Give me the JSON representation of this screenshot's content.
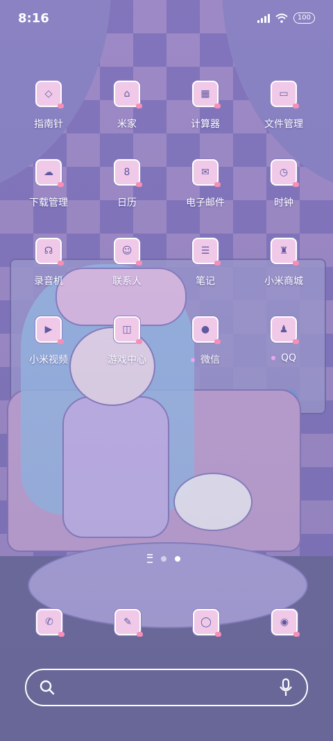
{
  "status_bar": {
    "time": "8:16",
    "battery": "100"
  },
  "apps": [
    {
      "label": "指南针",
      "icon": "compass-icon",
      "glyph": "◇"
    },
    {
      "label": "米家",
      "icon": "mi-home-icon",
      "glyph": "⌂"
    },
    {
      "label": "计算器",
      "icon": "calculator-icon",
      "glyph": "▦"
    },
    {
      "label": "文件管理",
      "icon": "folder-icon",
      "glyph": "▭"
    },
    {
      "label": "下载管理",
      "icon": "download-icon",
      "glyph": "☁"
    },
    {
      "label": "日历",
      "icon": "calendar-icon",
      "glyph": "8"
    },
    {
      "label": "电子邮件",
      "icon": "mail-icon",
      "glyph": "✉"
    },
    {
      "label": "时钟",
      "icon": "clock-icon",
      "glyph": "◷"
    },
    {
      "label": "录音机",
      "icon": "recorder-icon",
      "glyph": "☊"
    },
    {
      "label": "联系人",
      "icon": "contacts-icon",
      "glyph": "☺"
    },
    {
      "label": "笔记",
      "icon": "notes-icon",
      "glyph": "☰"
    },
    {
      "label": "小米商城",
      "icon": "shop-icon",
      "glyph": "♜"
    },
    {
      "label": "小米视频",
      "icon": "video-icon",
      "glyph": "▶"
    },
    {
      "label": "游戏中心",
      "icon": "game-icon",
      "glyph": "◫"
    },
    {
      "label": "微信",
      "icon": "wechat-icon",
      "glyph": "●"
    },
    {
      "label": "QQ",
      "icon": "qq-icon",
      "glyph": "♟"
    }
  ],
  "dock": [
    {
      "icon": "phone-icon",
      "glyph": "✆"
    },
    {
      "icon": "messages-icon",
      "glyph": "✎"
    },
    {
      "icon": "browser-icon",
      "glyph": "◯"
    },
    {
      "icon": "camera-icon",
      "glyph": "◉"
    }
  ],
  "page_indicator": {
    "pages": 2,
    "current": 2
  }
}
